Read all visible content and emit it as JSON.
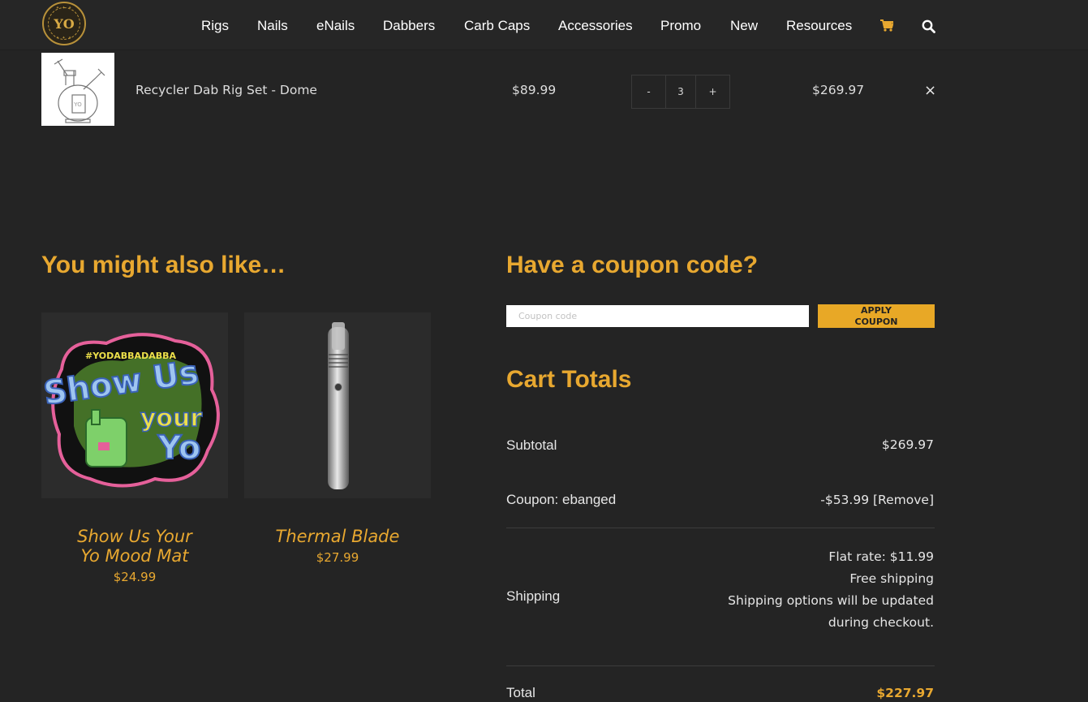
{
  "header": {
    "logo_alt": "YO",
    "nav": [
      "Rigs",
      "Nails",
      "eNails",
      "Dabbers",
      "Carb Caps",
      "Accessories",
      "Promo",
      "New",
      "Resources"
    ],
    "icons": {
      "cart": "cart-icon",
      "search": "search-icon"
    },
    "accent_color": "#e8a830"
  },
  "cart_item": {
    "name": "Recycler Dab Rig Set - Dome",
    "price": "$89.99",
    "qty_minus": "-",
    "quantity": "3",
    "qty_plus": "+",
    "subtotal": "$269.97",
    "remove": "×"
  },
  "related": {
    "heading": "You might also like…",
    "products": [
      {
        "name_line1": "Show Us Your",
        "name_line2": "Yo Mood Mat",
        "price": "$24.99",
        "image_text": "#YODABBADABBA"
      },
      {
        "name_line1": "Thermal Blade",
        "name_line2": "",
        "price": "$27.99"
      }
    ]
  },
  "coupon": {
    "heading": "Have a coupon code?",
    "placeholder": "Coupon code",
    "button_line1": "APPLY",
    "button_line2": "COUPON"
  },
  "totals": {
    "heading": "Cart Totals",
    "subtotal_label": "Subtotal",
    "subtotal_value": "$269.97",
    "coupon_label": "Coupon: ebanged",
    "coupon_value": "-$53.99",
    "coupon_remove": "[Remove]",
    "shipping_label": "Shipping",
    "shipping_lines": [
      "Flat rate: $11.99",
      "Free shipping",
      "Shipping options will be updated",
      "during checkout."
    ],
    "total_label": "Total",
    "total_value": "$227.97"
  }
}
